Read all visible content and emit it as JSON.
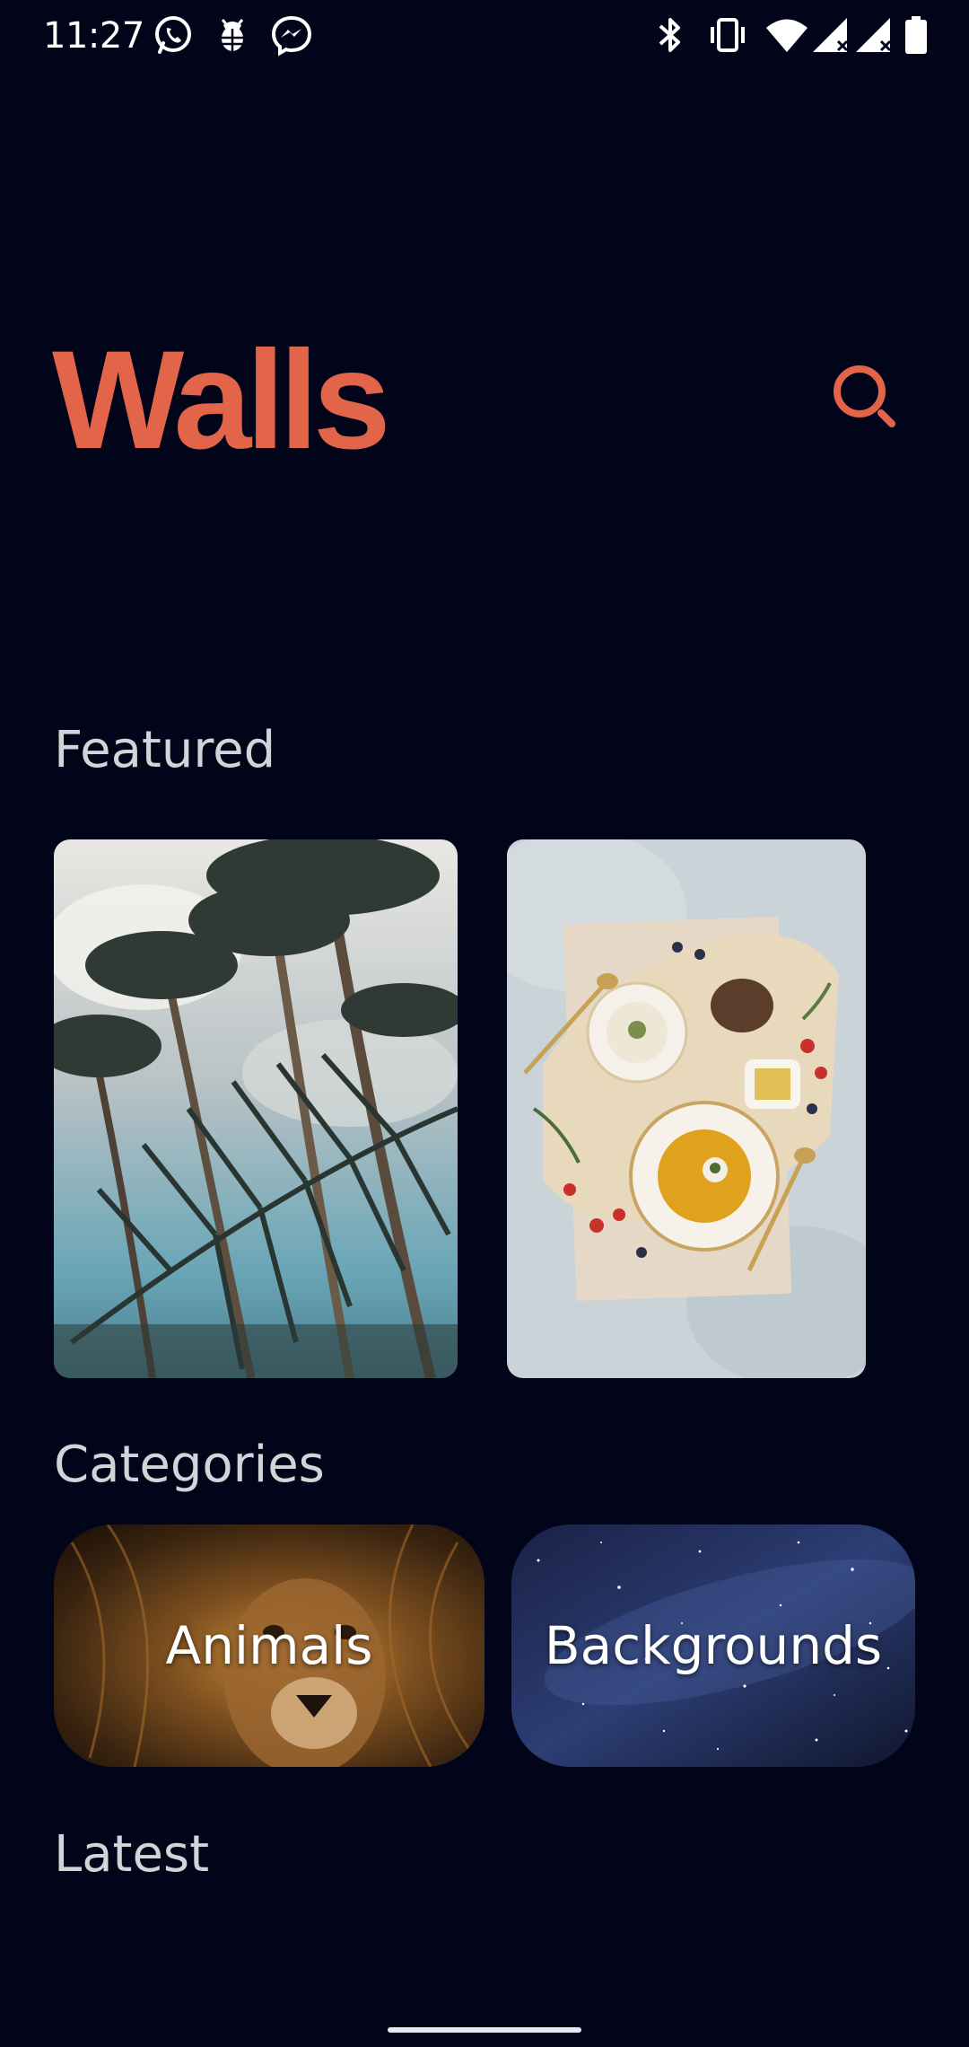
{
  "status_bar": {
    "time": "11:27",
    "left_icons": [
      "whatsapp-icon",
      "bug-icon",
      "messenger-icon"
    ],
    "right_icons": [
      "bluetooth-icon",
      "vibrate-icon",
      "wifi-icon",
      "signal-icon",
      "signal-icon",
      "battery-icon"
    ]
  },
  "header": {
    "title": "Walls",
    "search_icon": "search-icon"
  },
  "sections": {
    "featured": {
      "heading": "Featured"
    },
    "categories": {
      "heading": "Categories",
      "items": [
        {
          "label": "Animals"
        },
        {
          "label": "Backgrounds"
        }
      ]
    },
    "latest": {
      "heading": "Latest"
    }
  },
  "colors": {
    "background": "#02041a",
    "accent": "#e2654a",
    "heading_text": "#d4d4d8"
  }
}
